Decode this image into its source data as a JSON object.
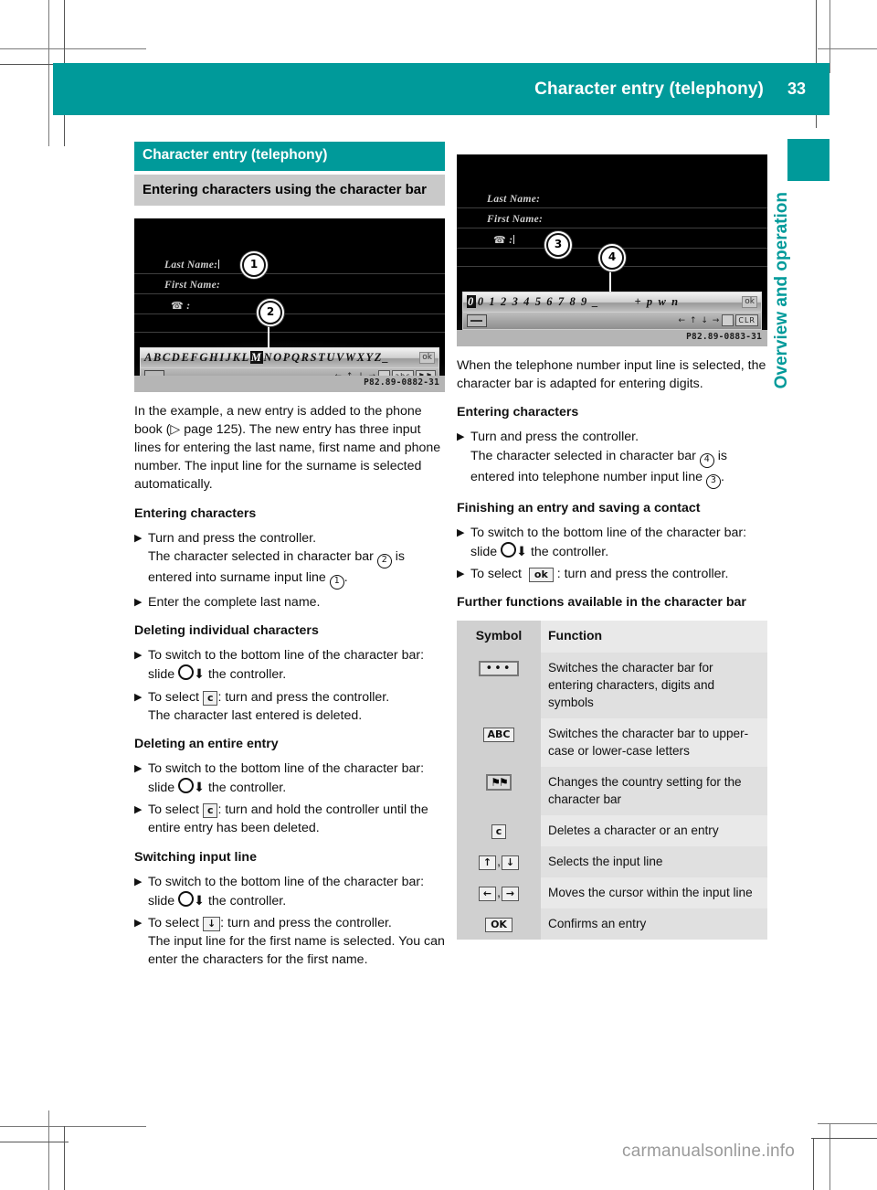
{
  "header": {
    "title": "Character entry (telephony)",
    "page_number": "33",
    "side_tab_label": "Overview and operation"
  },
  "chapter": {
    "title": "Character entry (telephony)",
    "section": "Entering characters using the character bar"
  },
  "figures": {
    "left": {
      "caption_id": "P82.89-0882-31",
      "field_last_name": "Last Name:",
      "field_first_name": "First Name:",
      "field_phone": ":",
      "char_bar": "ABCDEFGHIJKL",
      "char_bar_highlight": "M",
      "char_bar_rest": "NOPQRSTUVWXYZ_",
      "ok_label": "ok",
      "bottom_row_symbols": "- . , ← ↑ ↓ →",
      "callout_1": "1",
      "callout_2": "2"
    },
    "right": {
      "caption_id": "P82.89-0883-31",
      "field_last_name": "Last Name:",
      "field_first_name": "First Name:",
      "field_phone": ":",
      "char_bar_digits": "0 1 2 3 4 5 6 7 8 9 _",
      "char_bar_extra": "+ p w n",
      "ok_label": "ok",
      "bottom_row_symbols": "← ↑ ↓ →",
      "callout_3": "3",
      "callout_4": "4"
    }
  },
  "left_column": {
    "intro": "In the example, a new entry is added to the phone book (▷ page 125). The new entry has three input lines for entering the last name, first name and phone number. The input line for the surname is selected automatically.",
    "sections": [
      {
        "heading": "Entering characters",
        "steps": [
          {
            "parts": [
              "Turn and press the controller.",
              "The character selected in character bar ",
              "2",
              " is entered into surname input line ",
              "1",
              "."
            ]
          },
          {
            "text": "Enter the complete last name."
          }
        ]
      },
      {
        "heading": "Deleting individual characters",
        "steps": [
          {
            "text_a": "To switch to the bottom line of the character bar: slide ",
            "text_b": " the controller."
          },
          {
            "text_a": "To select ",
            "key": "c",
            "text_b": ": turn and press the controller.",
            "text_c": "The character last entered is deleted."
          }
        ]
      },
      {
        "heading": "Deleting an entire entry",
        "steps": [
          {
            "text_a": "To switch to the bottom line of the character bar: slide ",
            "text_b": " the controller."
          },
          {
            "text_a": "To select ",
            "key": "c",
            "text_b": ": turn and hold the controller until the entire entry has been deleted."
          }
        ]
      },
      {
        "heading": "Switching input line",
        "steps": [
          {
            "text_a": "To switch to the bottom line of the character bar: slide ",
            "text_b": " the controller."
          },
          {
            "text_a": "To select ",
            "key": "↓",
            "text_b": ": turn and press the controller.",
            "text_c": "The input line for the first name is selected. You can enter the characters for the first name."
          }
        ]
      }
    ]
  },
  "right_column": {
    "intro": "When the telephone number input line is selected, the character bar is adapted for entering digits.",
    "sections": [
      {
        "heading": "Entering characters",
        "steps": [
          {
            "line1": "Turn and press the controller.",
            "line2_a": "The character selected in character bar ",
            "ref1": "4",
            "line2_b": " is entered into telephone number input line ",
            "ref2": "3",
            "line2_c": "."
          }
        ]
      },
      {
        "heading": "Finishing an entry and saving a contact",
        "steps": [
          {
            "text_a": "To switch to the bottom line of the character bar: slide ",
            "text_b": " the controller."
          },
          {
            "text_a": "To select ",
            "key": "ok",
            "text_b": ": turn and press the controller."
          }
        ]
      }
    ],
    "table_heading": "Further functions available in the character bar",
    "table": {
      "columns": [
        "Symbol",
        "Function"
      ],
      "rows": [
        {
          "symbol_type": "dots",
          "symbol": "•••",
          "function": "Switches the character bar for entering characters, digits and symbols"
        },
        {
          "symbol_type": "key",
          "symbol": "ABC",
          "function": "Switches the character bar to upper-case or lower-case letters"
        },
        {
          "symbol_type": "flag",
          "symbol": "⚑⚑",
          "function": "Changes the country setting for the character bar"
        },
        {
          "symbol_type": "key",
          "symbol": "c",
          "function": "Deletes a character or an entry"
        },
        {
          "symbol_type": "key2",
          "symbol": "↑",
          "symbol2": "↓",
          "separator": ",",
          "function": "Selects the input line"
        },
        {
          "symbol_type": "key2",
          "symbol": "←",
          "symbol2": "→",
          "separator": ",",
          "function": "Moves the cursor within the input line"
        },
        {
          "symbol_type": "key",
          "symbol": "OK",
          "function": "Confirms an entry"
        }
      ]
    }
  },
  "watermark": "carmanualsonline.info",
  "colors": {
    "teal": "#009a9a",
    "section_gray": "#c9c9c9",
    "table_sym_bg": "#d0d0d0",
    "table_fn_bg": "#e9e9e9"
  }
}
